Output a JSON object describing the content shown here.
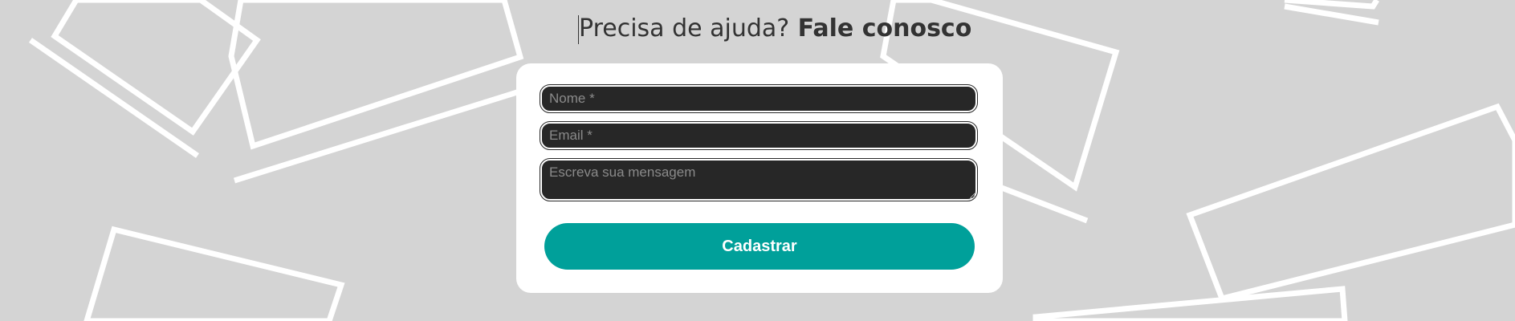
{
  "heading": {
    "prefix": "Precisa de ajuda?",
    "emphasis": "Fale conosco"
  },
  "form": {
    "name_placeholder": "Nome *",
    "email_placeholder": "Email *",
    "message_placeholder": "Escreva sua mensagem",
    "submit_label": "Cadastrar"
  },
  "colors": {
    "background": "#d4d4d4",
    "card": "#ffffff",
    "input": "#272727",
    "button": "#00a09a",
    "heading": "#333333"
  }
}
